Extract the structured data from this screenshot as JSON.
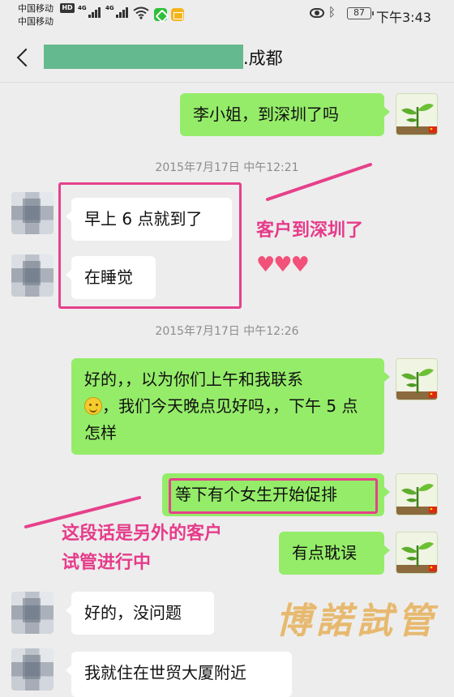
{
  "status_bar": {
    "carrier_1": "中国移动",
    "carrier_2": "中国移动",
    "hd": "HD",
    "net_1": "4G",
    "net_2": "4G",
    "battery": "87",
    "time": "下午3:43"
  },
  "header": {
    "title": ".成都"
  },
  "timestamps": {
    "t1": "2015年7月17日 中午12:21",
    "t2": "2015年7月17日 中午12:26"
  },
  "messages": {
    "m1": "李小姐，到深圳了吗",
    "m2": "早上 6 点就到了",
    "m3": "在睡觉",
    "m4_part1": "好的，，以为你们上午和我联系",
    "m4_part2": "，我们今天晚点见好吗，，下午 5 点怎样",
    "m5": "等下有个女生开始促排",
    "m6": "有点耽误",
    "m7": "好的，没问题",
    "m8": "我就住在世贸大厦附近"
  },
  "annotations": {
    "note_1": "客户到深圳了",
    "note_2_line1": "这段话是另外的客户",
    "note_2_line2": "试管进行中",
    "hearts": "♥♥♥",
    "watermark": "博諾試管",
    "color": "#e63b8a"
  },
  "icons": {
    "back": "chevron-left-icon",
    "self_avatar": "plant-sprout-icon",
    "emoji": "smile-emoji-icon"
  },
  "colors": {
    "self_bubble": "#95ec69",
    "other_bubble": "#ffffff",
    "background": "#ededed",
    "annotation": "#e6408b",
    "watermark": "#e7b769"
  }
}
